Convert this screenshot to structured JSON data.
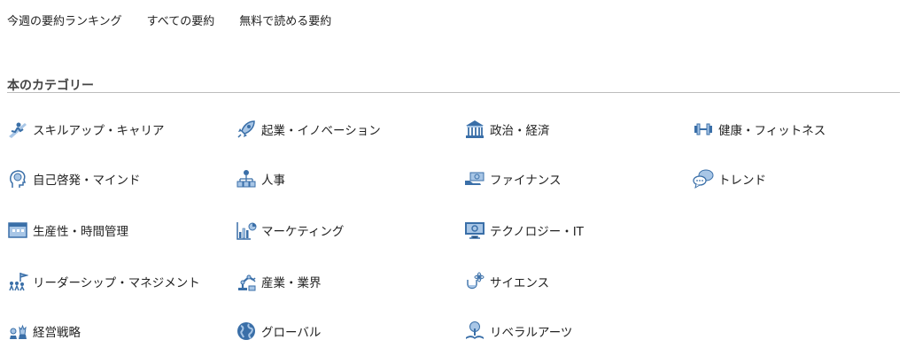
{
  "top_links": [
    "今週の要約ランキング",
    "すべての要約",
    "無料で読める要約"
  ],
  "section_title": "本のカテゴリー",
  "icon_colors": {
    "primary": "#3a6fa8",
    "light": "#a8c6e6"
  },
  "categories": [
    {
      "label": "スキルアップ・キャリア",
      "icon": "climbing-person-icon"
    },
    {
      "label": "起業・イノベーション",
      "icon": "rocket-icon"
    },
    {
      "label": "政治・経済",
      "icon": "government-building-icon"
    },
    {
      "label": "健康・フィットネス",
      "icon": "dumbbell-icon"
    },
    {
      "label": "自己啓発・マインド",
      "icon": "brain-head-icon"
    },
    {
      "label": "人事",
      "icon": "org-chart-icon"
    },
    {
      "label": "ファイナンス",
      "icon": "money-hand-icon"
    },
    {
      "label": "トレンド",
      "icon": "speech-bubbles-icon"
    },
    {
      "label": "生産性・時間管理",
      "icon": "calendar-icon"
    },
    {
      "label": "マーケティング",
      "icon": "bar-chart-icon"
    },
    {
      "label": "テクノロジー・IT",
      "icon": "monitor-icon"
    },
    {
      "label": "リーダーシップ・マネジメント",
      "icon": "leader-flag-icon"
    },
    {
      "label": "産業・業界",
      "icon": "robot-arm-icon"
    },
    {
      "label": "サイエンス",
      "icon": "flask-atom-icon"
    },
    {
      "label": "経営戦略",
      "icon": "chess-icon"
    },
    {
      "label": "グローバル",
      "icon": "globe-icon"
    },
    {
      "label": "リベラルアーツ",
      "icon": "tree-book-icon"
    }
  ]
}
